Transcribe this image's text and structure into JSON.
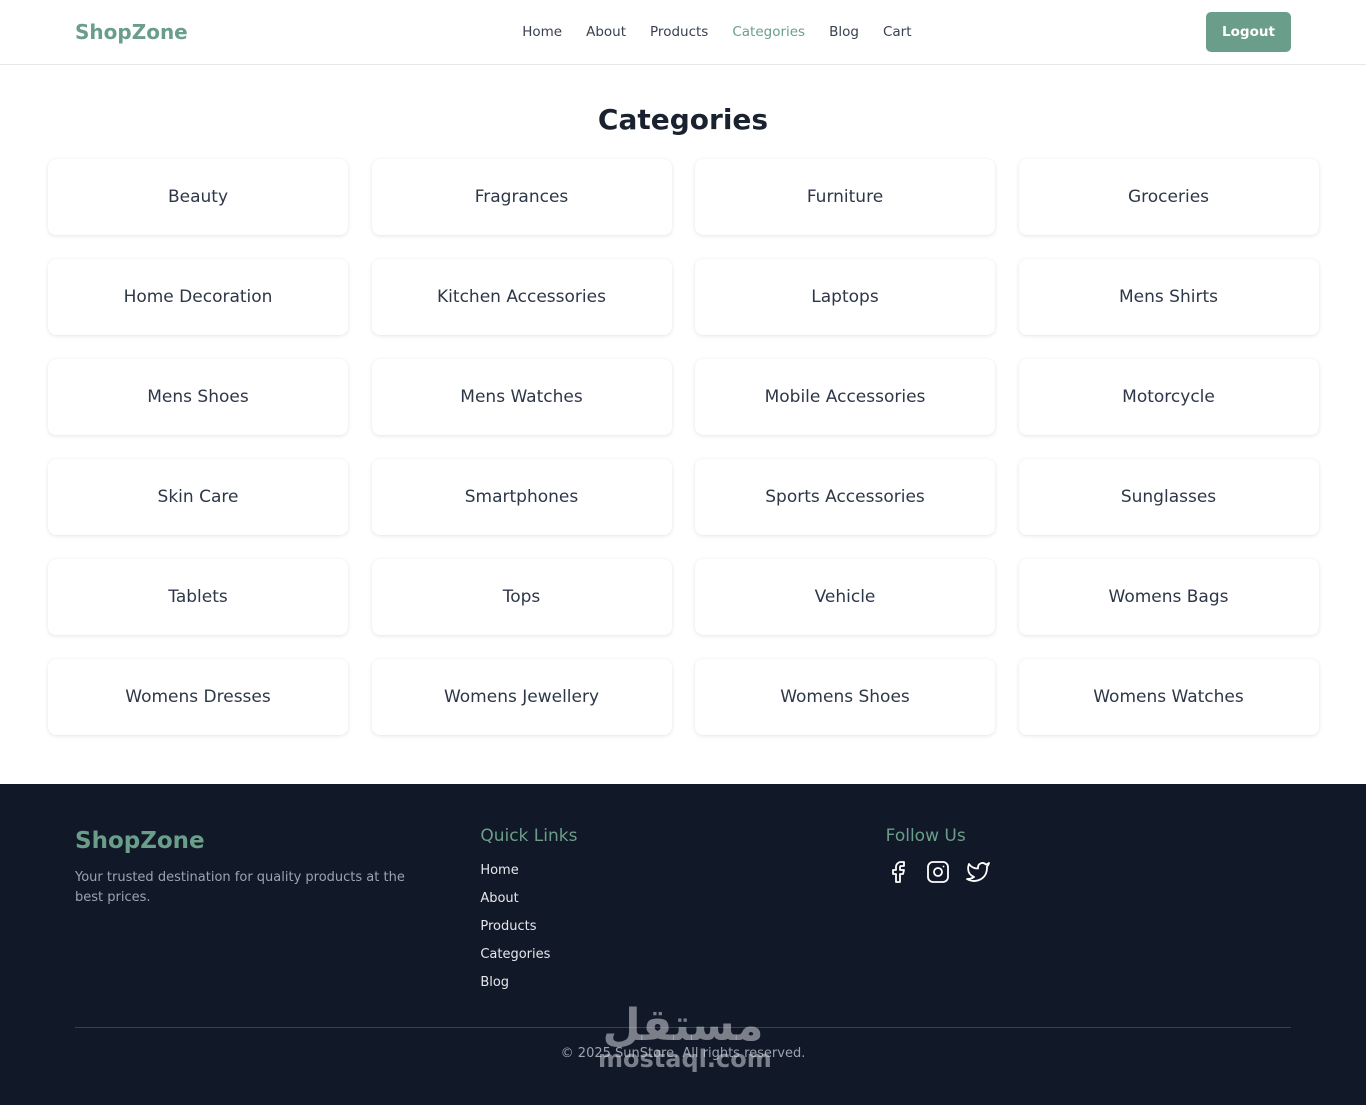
{
  "colors": {
    "accent": "#6b9e8a",
    "footer_bg": "#111827",
    "text_dark": "#1a2230"
  },
  "header": {
    "brand": "ShopZone",
    "nav": [
      {
        "label": "Home",
        "active": false
      },
      {
        "label": "About",
        "active": false
      },
      {
        "label": "Products",
        "active": false
      },
      {
        "label": "Categories",
        "active": true
      },
      {
        "label": "Blog",
        "active": false
      },
      {
        "label": "Cart",
        "active": false
      }
    ],
    "logout_label": "Logout"
  },
  "main": {
    "title": "Categories",
    "categories": [
      "Beauty",
      "Fragrances",
      "Furniture",
      "Groceries",
      "Home Decoration",
      "Kitchen Accessories",
      "Laptops",
      "Mens Shirts",
      "Mens Shoes",
      "Mens Watches",
      "Mobile Accessories",
      "Motorcycle",
      "Skin Care",
      "Smartphones",
      "Sports Accessories",
      "Sunglasses",
      "Tablets",
      "Tops",
      "Vehicle",
      "Womens Bags",
      "Womens Dresses",
      "Womens Jewellery",
      "Womens Shoes",
      "Womens Watches"
    ]
  },
  "footer": {
    "brand": "ShopZone",
    "tagline": "Your trusted destination for quality products at the best prices.",
    "quick_links_heading": "Quick Links",
    "quick_links": [
      "Home",
      "About",
      "Products",
      "Categories",
      "Blog"
    ],
    "follow_heading": "Follow Us",
    "social": [
      "facebook-icon",
      "instagram-icon",
      "twitter-icon"
    ],
    "copyright": "© 2025 SunStore. All rights reserved."
  },
  "watermark": {
    "arabic": "مستقل",
    "latin": "mostaql.com"
  }
}
